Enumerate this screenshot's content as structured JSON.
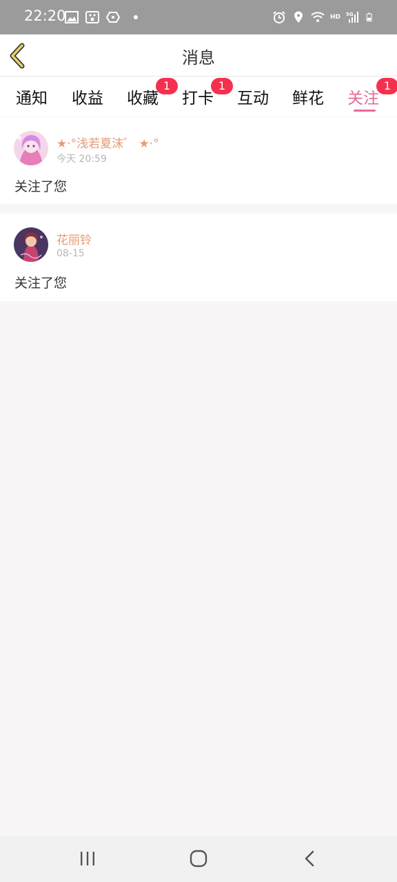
{
  "status_bar": {
    "time": "22:20",
    "left_icons": [
      "image-icon",
      "baidu-paw-icon",
      "hexagon-icon",
      "dot-icon"
    ],
    "right_icons": [
      "alarm-icon",
      "location-icon",
      "wifi-icon",
      "hd-label",
      "signal-5g-icon",
      "battery-icon"
    ],
    "hd_label": "HD",
    "fiveg_label": "5G"
  },
  "header": {
    "title": "消息",
    "back_icon": "chevron-left-icon",
    "back_color": "#c9b400"
  },
  "tabs": [
    {
      "label": "通知",
      "badge": ""
    },
    {
      "label": "收益",
      "badge": ""
    },
    {
      "label": "收藏",
      "badge": "1"
    },
    {
      "label": "打卡",
      "badge": "1"
    },
    {
      "label": "互动",
      "badge": ""
    },
    {
      "label": "鲜花",
      "badge": ""
    },
    {
      "label": "关注",
      "badge": "1"
    }
  ],
  "active_tab": "关注",
  "colors": {
    "accent": "#e8689b",
    "badge": "#f5304f",
    "username": "#e79a74",
    "timestamp": "#b6b6b6"
  },
  "messages": [
    {
      "username": "★·°浅若夏沫゛ ★·°",
      "time": "今天 20:59",
      "text": "关注了您"
    },
    {
      "username": "花丽铃",
      "time": "08-15",
      "text": "关注了您"
    }
  ],
  "nav_bar": {
    "icons": [
      "recent-apps-icon",
      "home-icon",
      "back-icon"
    ]
  }
}
